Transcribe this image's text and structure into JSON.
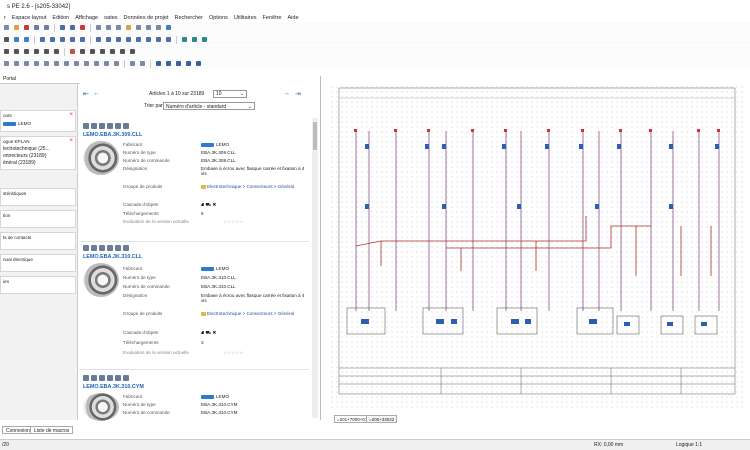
{
  "titlebar": {
    "title": "s PE 2.6 - [s205-33042]"
  },
  "menubar": {
    "items": [
      "r",
      "Espace layout",
      "Edition",
      "Affichage",
      "oates",
      "Données de projet",
      "Rechercher",
      "Options",
      "Utilitaires",
      "Fenêtre",
      "Aide"
    ]
  },
  "portal": {
    "label": "Portal"
  },
  "left_panel": {
    "items": [
      {
        "label": "cant",
        "sub": "LEMO"
      },
      {
        "label": "ogue EPLAN",
        "sub": "lectrotechnique (25...",
        "sub2": "onnecteurs (23189)",
        "sub3": "énéral (23189)"
      },
      {
        "label": "stéristiques"
      },
      {
        "label": "tion"
      },
      {
        "label": "ts de contacts"
      },
      {
        "label": "nual électrique"
      },
      {
        "label": "ien"
      }
    ]
  },
  "pagination": {
    "text": "Articles 1 à 10 sur 23189",
    "page_size": "10"
  },
  "sort": {
    "label": "Trier par",
    "value": "Numéro d'article - standard"
  },
  "field_labels": {
    "manufacturer": "Fabricant",
    "type_number": "Numéro de type",
    "order_number": "Numéro de commande",
    "designation": "Désignation",
    "product_groups": "Groupe de produits",
    "configurator": "Cascade d'objets",
    "downloads": "Téléchargements",
    "rating": "Evaluation de la version actuelle"
  },
  "articles": [
    {
      "title": "LEMO.EBA.3K.309.CLL",
      "manufacturer": "LEMO",
      "type": "EBA.3K.309.CLL",
      "order": "EBA.3K.309.CLL",
      "designation": "Embase à écrou avec flasque carrée et fixation à 4 vis",
      "group_path": "Electrotechnique > Connecteurs > Général",
      "downloads": "5",
      "rating": "☆☆☆☆☆"
    },
    {
      "title": "LEMO.EBA.3K.310.CLL",
      "manufacturer": "LEMO",
      "type": "EBA.3K.310.CLL",
      "order": "EBA.3K.310.CLL",
      "designation": "Embase à écrou avec flasque carrée et fixation à 4 vis",
      "group_path": "Electrotechnique > Connecteurs > Général",
      "downloads": "3",
      "rating": "☆☆☆☆☆"
    },
    {
      "title": "LEMO.EBA.3K.310.CYM",
      "manufacturer": "LEMO",
      "type": "EBA.3K.310.CYM",
      "order": "EBA.3K.310.CYM",
      "designation": "",
      "group_path": "",
      "downloads": "",
      "rating": ""
    }
  ],
  "schematic_tabs": [
    "=201+7000+01",
    "=205+33042"
  ],
  "bottom_tabs": [
    "Connexions",
    "Liste de macros"
  ],
  "status": {
    "left": "/20",
    "coords": "RX: 0,00 mm",
    "logic": "Logique 1:1"
  }
}
